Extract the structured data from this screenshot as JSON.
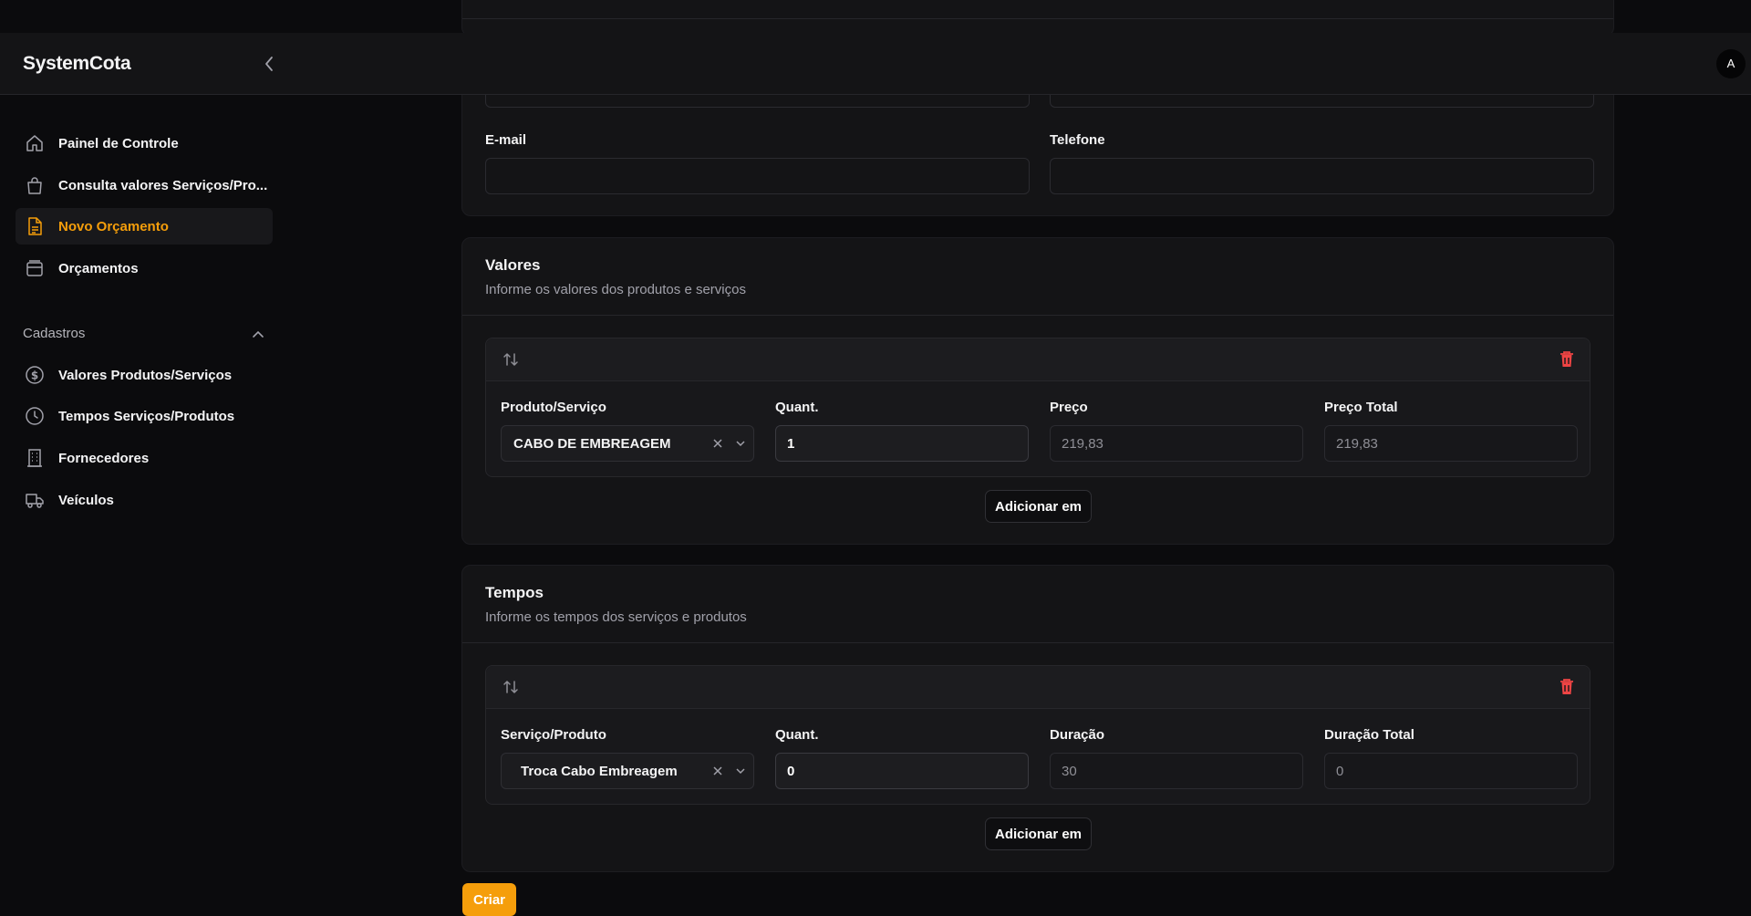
{
  "app": {
    "brand": "SystemCota",
    "avatar_initial": "A"
  },
  "sidebar": {
    "items": [
      {
        "label": "Painel de Controle",
        "icon": "home-icon"
      },
      {
        "label": "Consulta valores Serviços/Pro...",
        "icon": "shopping-bag-icon"
      },
      {
        "label": "Novo Orçamento",
        "icon": "document-icon",
        "active": true
      },
      {
        "label": "Orçamentos",
        "icon": "archive-icon"
      }
    ],
    "section": {
      "label": "Cadastros",
      "items": [
        {
          "label": "Valores Produtos/Serviços",
          "icon": "dollar-circle-icon"
        },
        {
          "label": "Tempos Serviços/Produtos",
          "icon": "clock-icon"
        },
        {
          "label": "Fornecedores",
          "icon": "building-icon"
        },
        {
          "label": "Veículos",
          "icon": "truck-icon"
        }
      ]
    }
  },
  "contact": {
    "email_label": "E-mail",
    "email_value": "",
    "phone_label": "Telefone",
    "phone_value": ""
  },
  "valores": {
    "title": "Valores",
    "subtitle": "Informe os valores dos produtos e serviços",
    "columns": {
      "product": "Produto/Serviço",
      "qty": "Quant.",
      "price": "Preço",
      "total": "Preço Total"
    },
    "row": {
      "product": "CABO DE EMBREAGEM",
      "qty": "1",
      "price": "219,83",
      "total": "219,83"
    },
    "add_label": "Adicionar em"
  },
  "tempos": {
    "title": "Tempos",
    "subtitle": "Informe os tempos dos serviços e produtos",
    "columns": {
      "service": "Serviço/Produto",
      "qty": "Quant.",
      "duration": "Duração",
      "total": "Duração Total"
    },
    "row": {
      "service": "Troca Cabo Embreagem",
      "qty": "0",
      "duration": "30",
      "total": "0"
    },
    "add_label": "Adicionar em"
  },
  "create_label": "Criar",
  "colors": {
    "accent": "#f59e0b",
    "danger": "#ef4444",
    "background": "#0b0b0d",
    "card": "#141416"
  }
}
